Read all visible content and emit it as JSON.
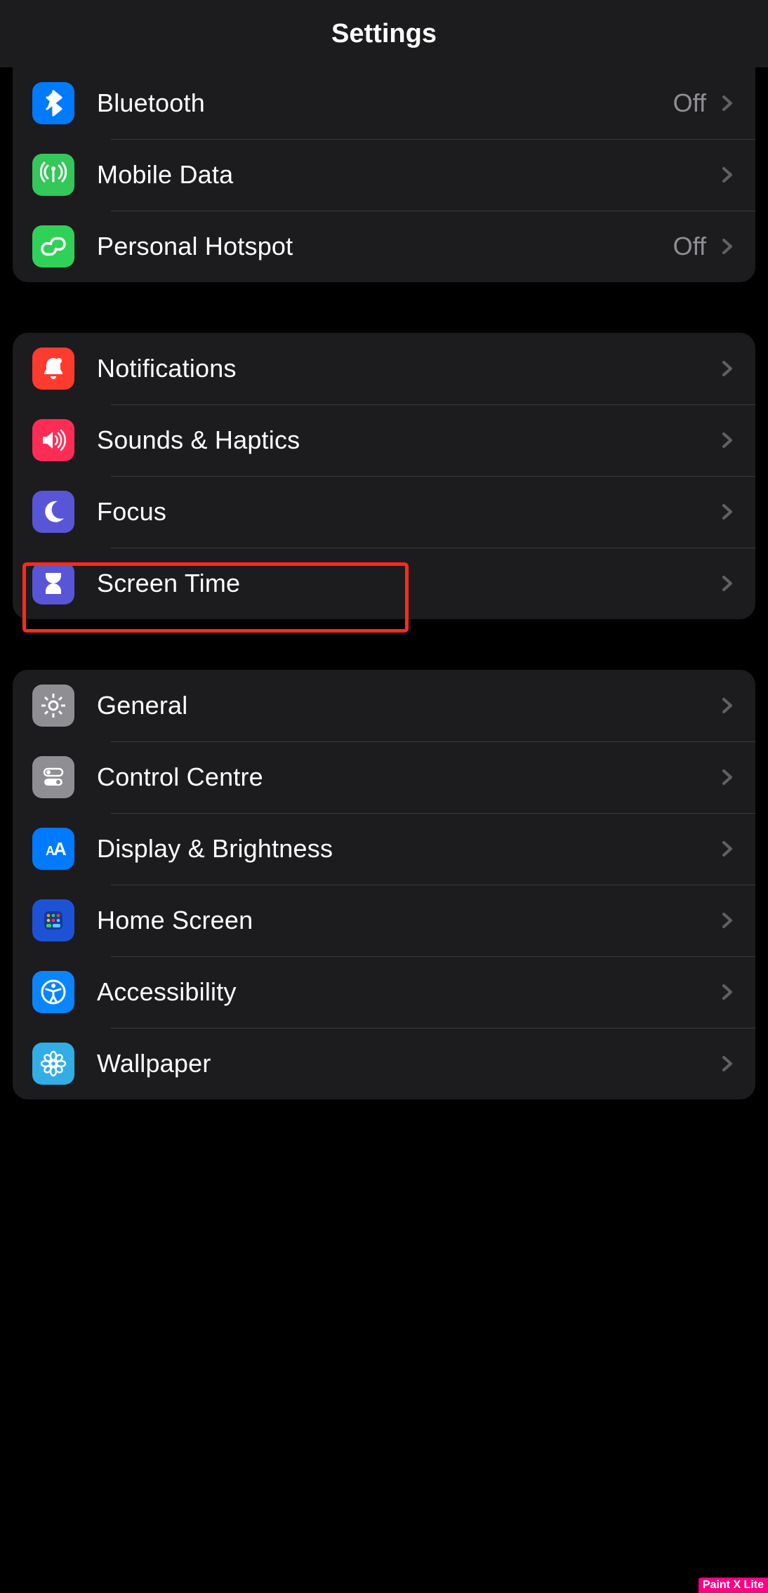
{
  "header": {
    "title": "Settings"
  },
  "groups": [
    {
      "rows": [
        {
          "id": "bluetooth",
          "label": "Bluetooth",
          "value": "Off",
          "icon": "bluetooth-icon",
          "bg": "bg-blue"
        },
        {
          "id": "mobile-data",
          "label": "Mobile Data",
          "value": "",
          "icon": "antenna-icon",
          "bg": "bg-green"
        },
        {
          "id": "personal-hotspot",
          "label": "Personal Hotspot",
          "value": "Off",
          "icon": "link-icon",
          "bg": "bg-green2"
        }
      ]
    },
    {
      "rows": [
        {
          "id": "notifications",
          "label": "Notifications",
          "value": "",
          "icon": "bell-icon",
          "bg": "bg-red"
        },
        {
          "id": "sounds-haptics",
          "label": "Sounds & Haptics",
          "value": "",
          "icon": "speaker-icon",
          "bg": "bg-pink"
        },
        {
          "id": "focus",
          "label": "Focus",
          "value": "",
          "icon": "moon-icon",
          "bg": "bg-indigo"
        },
        {
          "id": "screen-time",
          "label": "Screen Time",
          "value": "",
          "icon": "hourglass-icon",
          "bg": "bg-indigo",
          "highlighted": true
        }
      ]
    },
    {
      "rows": [
        {
          "id": "general",
          "label": "General",
          "value": "",
          "icon": "gear-icon",
          "bg": "bg-grey"
        },
        {
          "id": "control-centre",
          "label": "Control Centre",
          "value": "",
          "icon": "toggles-icon",
          "bg": "bg-grey"
        },
        {
          "id": "display-brightness",
          "label": "Display & Brightness",
          "value": "",
          "icon": "text-size-icon",
          "bg": "bg-blue"
        },
        {
          "id": "home-screen",
          "label": "Home Screen",
          "value": "",
          "icon": "apps-grid-icon",
          "bg": "bg-darkblue"
        },
        {
          "id": "accessibility",
          "label": "Accessibility",
          "value": "",
          "icon": "accessibility-icon",
          "bg": "bg-blue2"
        },
        {
          "id": "wallpaper",
          "label": "Wallpaper",
          "value": "",
          "icon": "flower-icon",
          "bg": "bg-cyan"
        }
      ]
    }
  ],
  "watermark": "Paint X Lite"
}
